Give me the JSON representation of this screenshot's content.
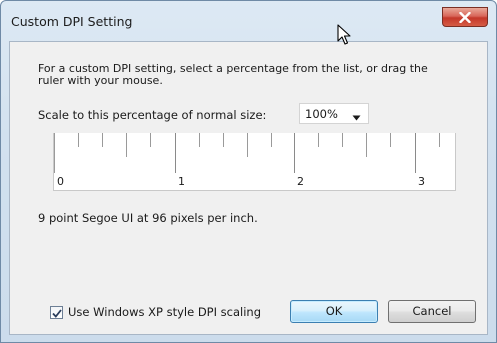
{
  "window": {
    "title": "Custom DPI Setting"
  },
  "description": "For a custom DPI setting, select a percentage from the list, or drag the ruler with your mouse.",
  "scale": {
    "label": "Scale to this percentage of normal size:",
    "selected": "100%"
  },
  "ruler": {
    "labels": [
      "0",
      "1",
      "2",
      "3"
    ]
  },
  "font_info": "9 point Segoe UI at 96 pixels per inch.",
  "xp_scaling": {
    "label": "Use Windows XP style DPI scaling",
    "checked": true
  },
  "buttons": {
    "ok": "OK",
    "cancel": "Cancel"
  },
  "colors": {
    "close_button": "#c4372a",
    "ok_button_border": "#3c7fb1",
    "dialog_frame": "#d2e1ef"
  },
  "icons": {
    "close": "close-icon",
    "cursor": "mouse-cursor-icon",
    "dropdown": "chevron-down-icon",
    "checkmark": "checkmark-icon"
  }
}
